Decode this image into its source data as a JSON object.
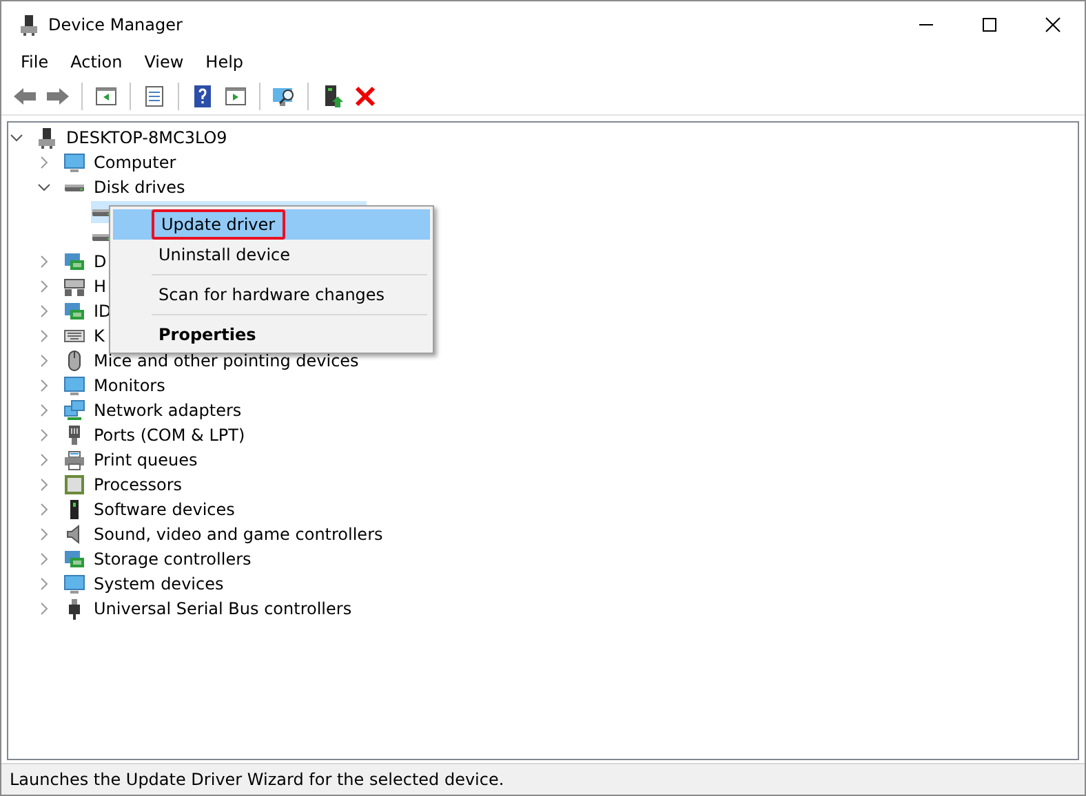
{
  "window": {
    "title": "Device Manager"
  },
  "menu_bar": [
    "File",
    "Action",
    "View",
    "Help"
  ],
  "toolbar": [
    {
      "kind": "back"
    },
    {
      "kind": "forward"
    },
    {
      "kind": "sep"
    },
    {
      "kind": "panel"
    },
    {
      "kind": "sep"
    },
    {
      "kind": "properties"
    },
    {
      "kind": "sep"
    },
    {
      "kind": "help"
    },
    {
      "kind": "panel2"
    },
    {
      "kind": "sep"
    },
    {
      "kind": "scan"
    },
    {
      "kind": "sep"
    },
    {
      "kind": "update"
    },
    {
      "kind": "remove"
    }
  ],
  "tree": [
    {
      "label": "DESKTOP-8MC3LO9",
      "kind": "pc",
      "expanded": true,
      "children": [
        {
          "label": "Computer",
          "kind": "monitor",
          "expanded": false
        },
        {
          "label": "Disk drives",
          "kind": "disk",
          "expanded": true,
          "children": [
            {
              "kind": "disk",
              "selected": true
            },
            {
              "kind": "disk",
              "selected": false
            }
          ]
        },
        {
          "label": "D",
          "kind": "card",
          "expanded": false
        },
        {
          "label": "H",
          "kind": "hid",
          "expanded": false
        },
        {
          "label": "ID",
          "kind": "card",
          "expanded": false
        },
        {
          "label": "K",
          "kind": "keyboard",
          "expanded": false
        },
        {
          "label": "Mice and other pointing devices",
          "kind": "mouse",
          "expanded": false
        },
        {
          "label": "Monitors",
          "kind": "monitor",
          "expanded": false
        },
        {
          "label": "Network adapters",
          "kind": "network",
          "expanded": false
        },
        {
          "label": "Ports (COM & LPT)",
          "kind": "port",
          "expanded": false
        },
        {
          "label": "Print queues",
          "kind": "printer",
          "expanded": false
        },
        {
          "label": "Processors",
          "kind": "chip",
          "expanded": false
        },
        {
          "label": "Software devices",
          "kind": "tower",
          "expanded": false
        },
        {
          "label": "Sound, video and game controllers",
          "kind": "speaker",
          "expanded": false
        },
        {
          "label": "Storage controllers",
          "kind": "card",
          "expanded": false
        },
        {
          "label": "System devices",
          "kind": "monitor",
          "expanded": false
        },
        {
          "label": "Universal Serial Bus controllers",
          "kind": "usb",
          "expanded": false
        }
      ]
    }
  ],
  "context_menu": [
    {
      "kind": "item",
      "label": "Update driver",
      "selected": true,
      "bold": false,
      "annotated": true
    },
    {
      "kind": "item",
      "label": "Uninstall device",
      "selected": false,
      "bold": false,
      "annotated": false
    },
    {
      "kind": "separator"
    },
    {
      "kind": "item",
      "label": "Scan for hardware changes",
      "selected": false,
      "bold": false,
      "annotated": false
    },
    {
      "kind": "separator"
    },
    {
      "kind": "item",
      "label": "Properties",
      "selected": false,
      "bold": true,
      "annotated": false
    }
  ],
  "status_bar": "Launches the Update Driver Wizard for the selected device."
}
